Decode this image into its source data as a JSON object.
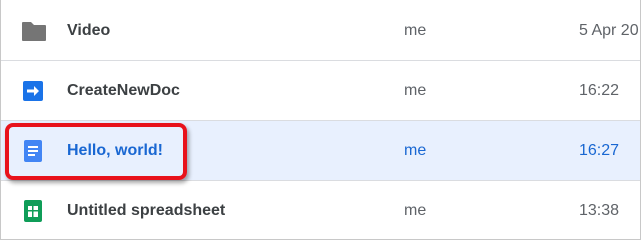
{
  "files": [
    {
      "name": "Video",
      "owner": "me",
      "modified": "5 Apr 20",
      "icon": "folder-icon"
    },
    {
      "name": "CreateNewDoc",
      "owner": "me",
      "modified": "16:22",
      "icon": "apps-script-icon"
    },
    {
      "name": "Hello, world!",
      "owner": "me",
      "modified": "16:27",
      "icon": "google-docs-icon",
      "selected": true
    },
    {
      "name": "Untitled spreadsheet",
      "owner": "me",
      "modified": "13:38",
      "icon": "google-sheets-icon"
    }
  ],
  "colors": {
    "selected_bg": "#e8f0fe",
    "selected_text": "#1967d2",
    "highlight_border": "#e8121b",
    "docs_blue": "#4285f4",
    "sheets_green": "#0f9d58",
    "script_blue": "#1a73e8",
    "folder_gray": "#757575"
  }
}
